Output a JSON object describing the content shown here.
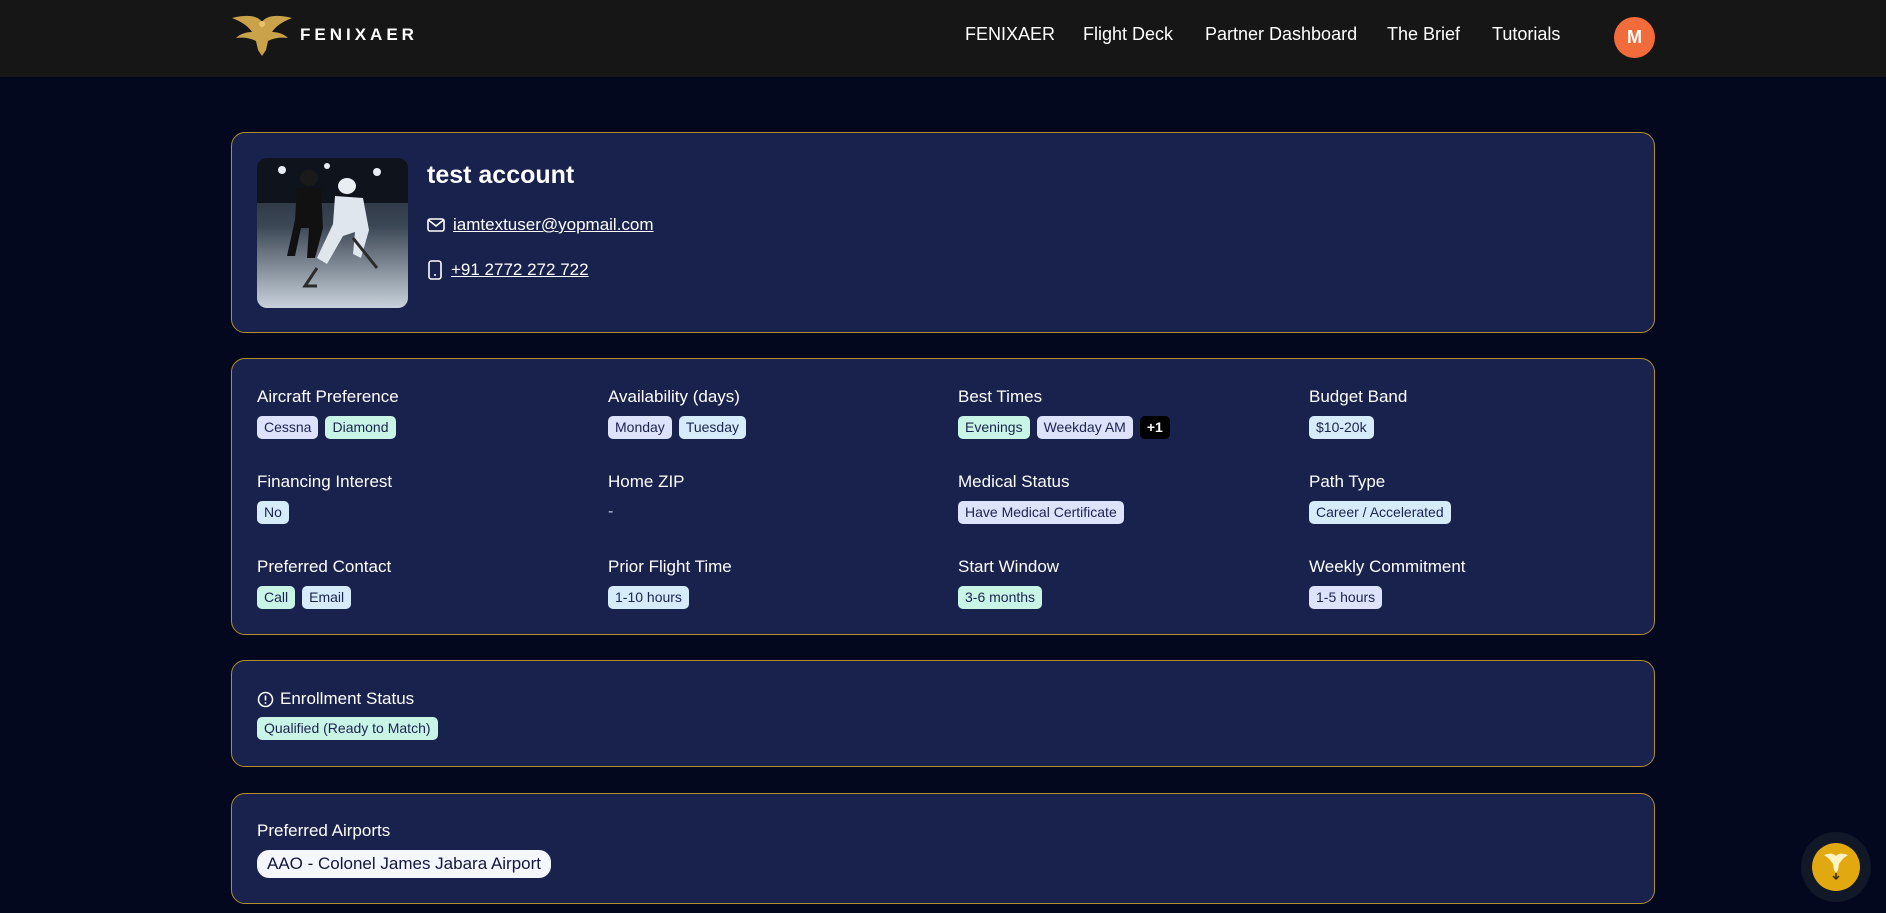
{
  "header": {
    "brand": "FENIXAER",
    "nav": [
      "FENIXAER",
      "Flight Deck",
      "Partner Dashboard",
      "The Brief",
      "Tutorials"
    ],
    "avatar_initial": "M"
  },
  "profile": {
    "name": "test account",
    "email": "iamtextuser@yopmail.com",
    "phone": "+91 2772 272 722"
  },
  "details": {
    "aircraft_preference": {
      "label": "Aircraft Preference",
      "chips": [
        "Cessna",
        "Diamond"
      ]
    },
    "availability": {
      "label": "Availability (days)",
      "chips": [
        "Monday",
        "Tuesday"
      ]
    },
    "best_times": {
      "label": "Best Times",
      "chips": [
        "Evenings",
        "Weekday AM"
      ],
      "more": "+1"
    },
    "budget_band": {
      "label": "Budget Band",
      "chips": [
        "$10-20k"
      ]
    },
    "financing_interest": {
      "label": "Financing Interest",
      "chips": [
        "No"
      ]
    },
    "home_zip": {
      "label": "Home ZIP",
      "value": "-"
    },
    "medical_status": {
      "label": "Medical Status",
      "chips": [
        "Have Medical Certificate"
      ]
    },
    "path_type": {
      "label": "Path Type",
      "chips": [
        "Career / Accelerated"
      ]
    },
    "preferred_contact": {
      "label": "Preferred Contact",
      "chips": [
        "Call",
        "Email"
      ]
    },
    "prior_flight_time": {
      "label": "Prior Flight Time",
      "chips": [
        "1-10 hours"
      ]
    },
    "start_window": {
      "label": "Start Window",
      "chips": [
        "3-6 months"
      ]
    },
    "weekly_commitment": {
      "label": "Weekly Commitment",
      "chips": [
        "1-5 hours"
      ]
    }
  },
  "enrollment": {
    "label": "Enrollment Status",
    "status": "Qualified (Ready to Match)"
  },
  "airports": {
    "label": "Preferred Airports",
    "items": [
      "AAO - Colonel James Jabara Airport"
    ]
  },
  "colors": {
    "background": "#03081f",
    "card": "#19214d",
    "border": "#b08f2c",
    "avatar": "#f26b3a",
    "gold": "#e2a80f"
  }
}
